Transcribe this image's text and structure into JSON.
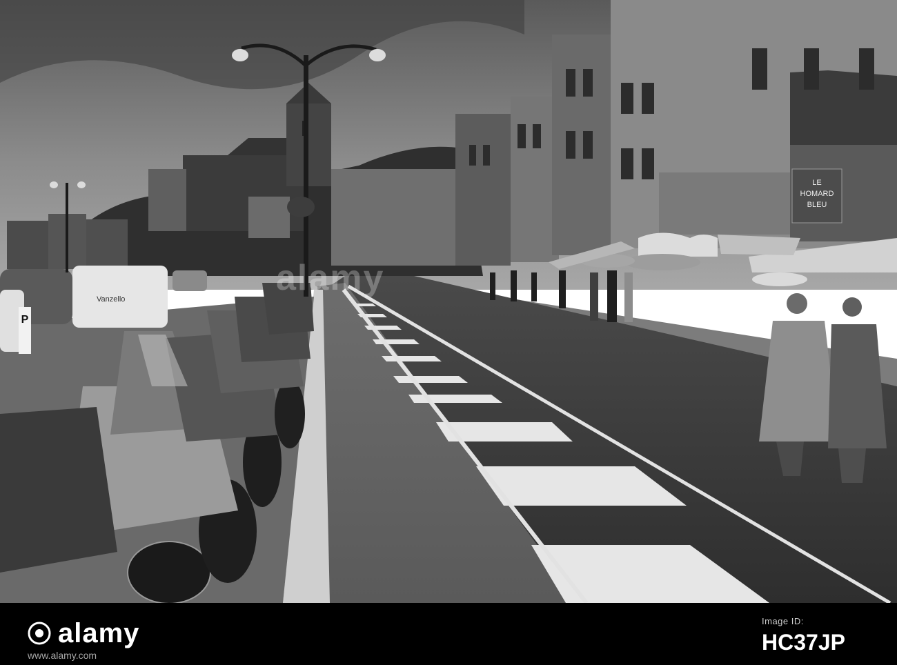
{
  "photo": {
    "sign_text_1": "LE",
    "sign_text_2": "HOMARD",
    "sign_text_3": "BLEU",
    "parking_sign": "P",
    "van_text": "Vanzello"
  },
  "watermark": {
    "text": "alamy"
  },
  "footer": {
    "brand": "alamy",
    "image_id_label": "Image ID:",
    "image_id": "HC37JP",
    "url": "www.alamy.com"
  },
  "colors": {
    "footer_bg": "#000000",
    "footer_text": "#ffffff"
  }
}
